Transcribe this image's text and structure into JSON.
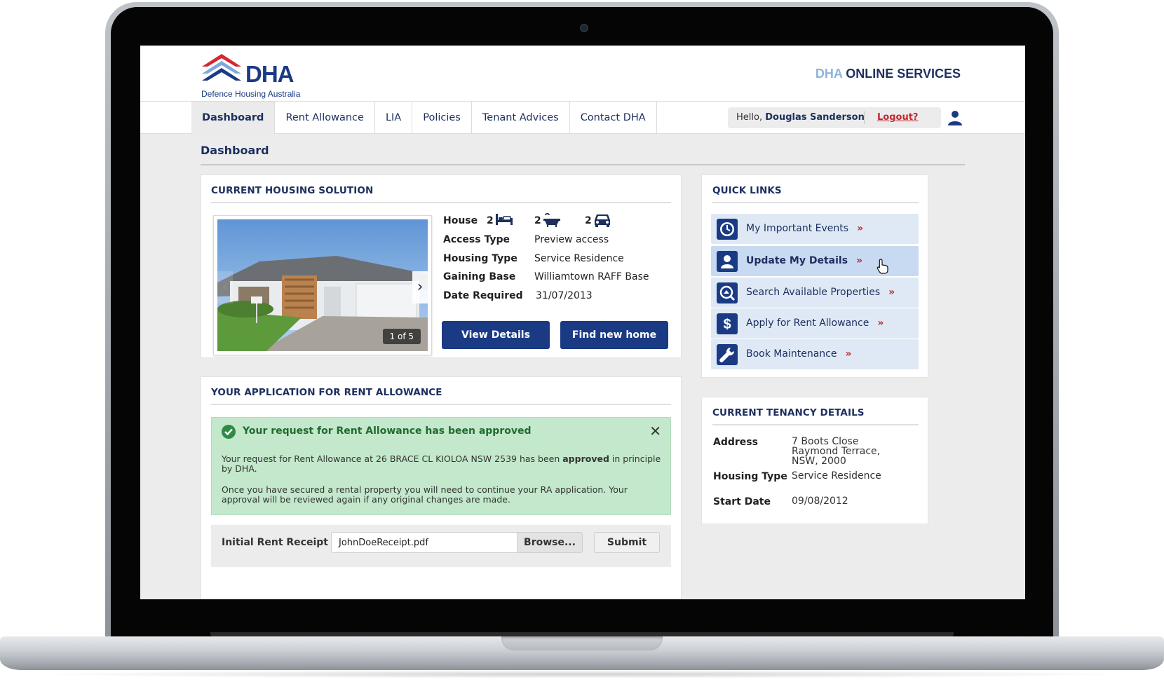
{
  "brand": {
    "logo_text": "DHA",
    "logo_subtitle": "Defence Housing Australia",
    "site_title_accent": "DHA",
    "site_title_rest": "ONLINE SERVICES",
    "primary_color": "#1a3a84",
    "accent_red": "#c4262e"
  },
  "nav": {
    "tabs": [
      {
        "label": "Dashboard",
        "active": true
      },
      {
        "label": "Rent Allowance",
        "active": false
      },
      {
        "label": "LIA",
        "active": false
      },
      {
        "label": "Policies",
        "active": false
      },
      {
        "label": "Tenant Advices",
        "active": false
      },
      {
        "label": "Contact DHA",
        "active": false
      }
    ],
    "greeting_prefix": "Hello, ",
    "user_name": "Douglas Sanderson",
    "logout_label": "Logout?",
    "user_icon": "user-icon"
  },
  "page": {
    "title": "Dashboard"
  },
  "housing": {
    "title": "CURRENT HOUSING SOLUTION",
    "photo_counter": "1 of 5",
    "type_label": "House",
    "bedrooms": "2",
    "bathrooms": "2",
    "car_spaces": "2",
    "details": [
      {
        "label": "Access Type",
        "value": "Preview access"
      },
      {
        "label": "Housing Type",
        "value": "Service Residence"
      },
      {
        "label": "Gaining Base",
        "value": "Williamtown RAFF Base"
      },
      {
        "label": "Date Required",
        "value": "31/07/2013"
      }
    ],
    "view_details_label": "View Details",
    "find_new_home_label": "Find new home"
  },
  "quick_links": {
    "title": "QUICK LINKS",
    "chevron": "»",
    "items": [
      {
        "label": "My Important Events",
        "icon": "clock-icon"
      },
      {
        "label": "Update My Details",
        "icon": "person-icon",
        "active": true
      },
      {
        "label": "Search Available Properties",
        "icon": "search-icon"
      },
      {
        "label": "Apply for Rent Allowance",
        "icon": "dollar-icon"
      },
      {
        "label": "Book Maintenance",
        "icon": "wrench-icon"
      }
    ]
  },
  "tenancy": {
    "title": "CURRENT TENANCY DETAILS",
    "rows": [
      {
        "label": "Address",
        "value": "7 Boots Close Raymond Terrace, NSW, 2000"
      },
      {
        "label": "Housing Type",
        "value": "Service Residence"
      },
      {
        "label": "Start Date",
        "value": "09/08/2012"
      }
    ]
  },
  "rent_allowance": {
    "title": "YOUR APPLICATION FOR RENT ALLOWANCE",
    "alert_title": "Your request for Rent Allowance has been approved",
    "alert_p1_before": "Your request for Rent Allowance at 26 BRACE CL KIOLOA NSW 2539 has been ",
    "alert_p1_bold": "approved",
    "alert_p1_after": " in principle by DHA.",
    "alert_p2": "Once you have secured a rental property you will need to continue your RA application. Your approval will be reviewed again if any original changes are made.",
    "close_symbol": "✕",
    "upload_label": "Initial Rent Receipt",
    "file_value": "JohnDoeReceipt.pdf",
    "browse_label": "Browse...",
    "submit_label": "Submit"
  }
}
